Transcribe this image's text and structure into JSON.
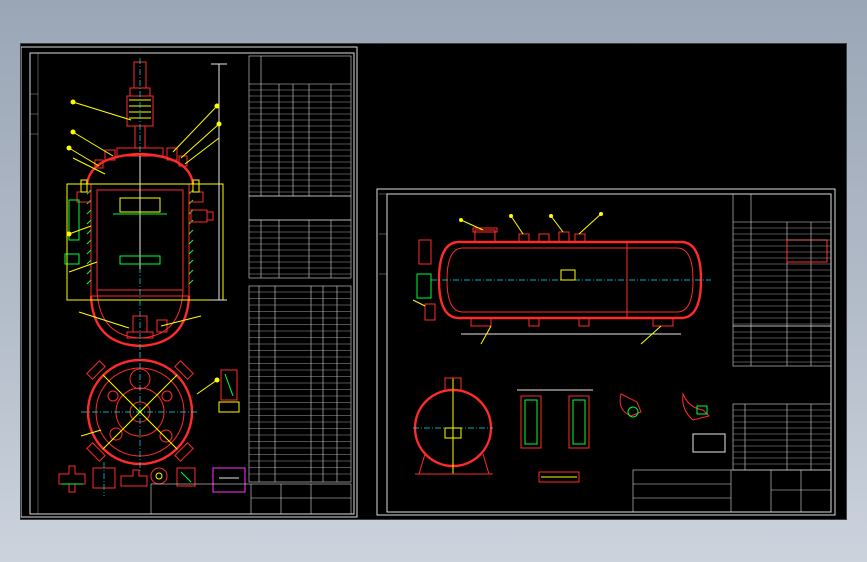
{
  "colors": {
    "background": "#000000",
    "vessel_outline": "#ff2a2a",
    "leader_lines": "#ffff00",
    "hatching": "#00ff3a",
    "center_lines": "#00e6ff",
    "table_lines": "#dcdcdc",
    "note_box": "#ff33ff"
  },
  "left_sheet": {
    "views": [
      "reactor-elevation",
      "reactor-plan-view",
      "detail-views"
    ]
  },
  "right_sheet": {
    "views": [
      "horizontal-tank-elevation",
      "end-view",
      "support-detail",
      "flange-details"
    ]
  }
}
